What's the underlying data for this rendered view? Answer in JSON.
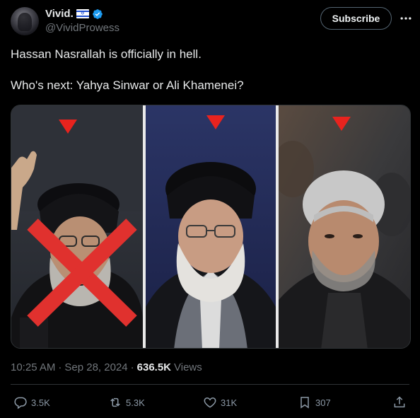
{
  "author": {
    "display_name": "Vivid.",
    "handle": "@VividProwess",
    "flag_icon": "israel-flag-icon",
    "verified_icon": "verified-badge-icon",
    "verified_color": "#1d9bf0"
  },
  "header": {
    "subscribe_label": "Subscribe",
    "more_icon": "more-dots-icon"
  },
  "tweet": {
    "line1": "Hassan Nasrallah is officially in hell.",
    "line2": "Who's next: Yahya Sinwar or Ali Khamenei?"
  },
  "media": {
    "panels": [
      {
        "subject": "left-portrait",
        "marker": "red-triangle",
        "crossed_out": true
      },
      {
        "subject": "center-portrait",
        "marker": "red-triangle",
        "crossed_out": false
      },
      {
        "subject": "right-portrait",
        "marker": "red-triangle",
        "crossed_out": false
      }
    ],
    "marker_color": "#e8231e",
    "cross_color": "#e0312e"
  },
  "meta": {
    "time": "10:25 AM",
    "separator": "·",
    "date": "Sep 28, 2024",
    "separator2": "·",
    "views_count": "636.5K",
    "views_label": "Views"
  },
  "actions": {
    "reply_count": "3.5K",
    "retweet_count": "5.3K",
    "like_count": "31K",
    "bookmark_count": "307",
    "reply_icon": "reply-icon",
    "retweet_icon": "retweet-icon",
    "like_icon": "heart-icon",
    "bookmark_icon": "bookmark-icon",
    "share_icon": "share-icon"
  },
  "colors": {
    "background": "#000000",
    "text": "#e7e9ea",
    "muted": "#71767b",
    "accent": "#1d9bf0"
  }
}
